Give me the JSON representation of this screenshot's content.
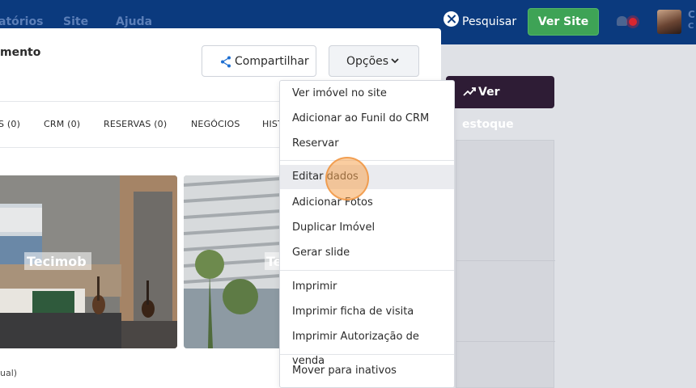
{
  "topnav": {
    "links": [
      "atórios",
      "Site",
      "Ajuda"
    ],
    "search_label": "Pesquisar",
    "ver_site_label": "Ver Site",
    "user_initials": [
      "C",
      "C"
    ]
  },
  "background": {
    "ver_estoque_label": "Ver estoque"
  },
  "panel": {
    "title": "mento",
    "share_label": "Compartilhar",
    "options_label": "Opções",
    "tabs": [
      "S (0)",
      "CRM (0)",
      "RESERVAS (0)",
      "NEGÓCIOS",
      "HIST"
    ],
    "photo1_watermark": "Tecimob",
    "photo2_watermark": "Te",
    "caption": "ual)"
  },
  "dropdown": {
    "items": [
      "Ver imóvel no site",
      "Adicionar ao Funil do CRM",
      "Reservar",
      "Editar dados",
      "Adicionar Fotos",
      "Duplicar Imóvel",
      "Gerar slide",
      "Imprimir",
      "Imprimir ficha de visita",
      "Imprimir Autorização de venda",
      "Mover para inativos"
    ],
    "hovered_item": "Editar dados"
  },
  "colors": {
    "nav_bg": "#0b3a7e",
    "ver_site_green": "#3ea356",
    "ver_estoque_bg": "#2e1c35",
    "hover_bg": "#eaebef",
    "click_marker": "#f6a452"
  }
}
